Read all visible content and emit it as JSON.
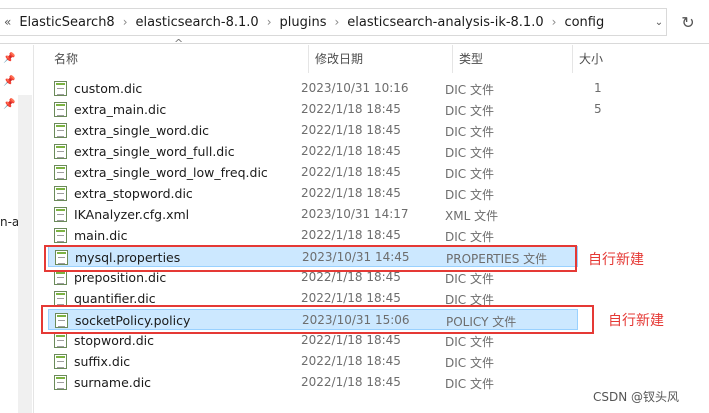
{
  "address": {
    "back_glyph": "«",
    "crumbs": [
      "ElasticSearch8",
      "elasticsearch-8.1.0",
      "plugins",
      "elasticsearch-analysis-ik-8.1.0",
      "config"
    ],
    "separator": "›",
    "dropdown_glyph": "⌄",
    "refresh_glyph": "↻"
  },
  "nav": {
    "partial_text": "n-a"
  },
  "columns": {
    "name": "名称",
    "date": "修改日期",
    "type": "类型",
    "size": "大小"
  },
  "files": [
    {
      "name": "custom.dic",
      "date": "2023/10/31 10:16",
      "type": "DIC 文件",
      "size": "1"
    },
    {
      "name": "extra_main.dic",
      "date": "2022/1/18 18:45",
      "type": "DIC 文件",
      "size": "5"
    },
    {
      "name": "extra_single_word.dic",
      "date": "2022/1/18 18:45",
      "type": "DIC 文件",
      "size": ""
    },
    {
      "name": "extra_single_word_full.dic",
      "date": "2022/1/18 18:45",
      "type": "DIC 文件",
      "size": ""
    },
    {
      "name": "extra_single_word_low_freq.dic",
      "date": "2022/1/18 18:45",
      "type": "DIC 文件",
      "size": ""
    },
    {
      "name": "extra_stopword.dic",
      "date": "2022/1/18 18:45",
      "type": "DIC 文件",
      "size": ""
    },
    {
      "name": "IKAnalyzer.cfg.xml",
      "date": "2023/10/31 14:17",
      "type": "XML 文件",
      "size": ""
    },
    {
      "name": "main.dic",
      "date": "2022/1/18 18:45",
      "type": "DIC 文件",
      "size": ""
    },
    {
      "name": "mysql.properties",
      "date": "2023/10/31 14:45",
      "type": "PROPERTIES 文件",
      "size": ""
    },
    {
      "name": "preposition.dic",
      "date": "2022/1/18 18:45",
      "type": "DIC 文件",
      "size": ""
    },
    {
      "name": "quantifier.dic",
      "date": "2022/1/18 18:45",
      "type": "DIC 文件",
      "size": ""
    },
    {
      "name": "socketPolicy.policy",
      "date": "2023/10/31 15:06",
      "type": "POLICY 文件",
      "size": ""
    },
    {
      "name": "stopword.dic",
      "date": "2022/1/18 18:45",
      "type": "DIC 文件",
      "size": ""
    },
    {
      "name": "suffix.dic",
      "date": "2022/1/18 18:45",
      "type": "DIC 文件",
      "size": ""
    },
    {
      "name": "surname.dic",
      "date": "2022/1/18 18:45",
      "type": "DIC 文件",
      "size": ""
    }
  ],
  "annotations": {
    "label_1": "自行新建",
    "label_2": "自行新建"
  },
  "watermark": "CSDN @钗头风",
  "colors": {
    "selection": "#cce8ff",
    "annotation": "#e53935"
  }
}
